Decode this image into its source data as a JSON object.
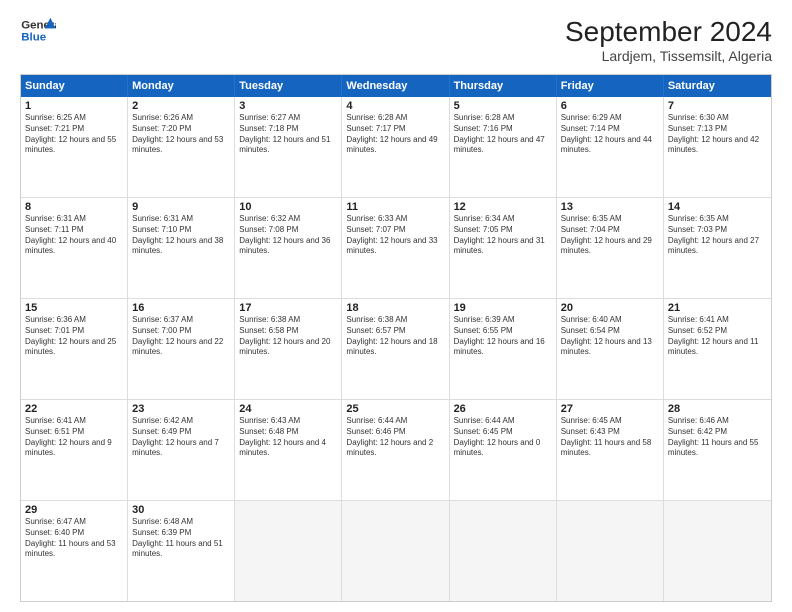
{
  "header": {
    "logo_line1": "General",
    "logo_line2": "Blue",
    "title": "September 2024",
    "subtitle": "Lardjem, Tissemsilt, Algeria"
  },
  "calendar": {
    "days": [
      "Sunday",
      "Monday",
      "Tuesday",
      "Wednesday",
      "Thursday",
      "Friday",
      "Saturday"
    ],
    "rows": [
      [
        {
          "day": "1",
          "rise": "6:25 AM",
          "set": "7:21 PM",
          "daylight": "12 hours and 55 minutes."
        },
        {
          "day": "2",
          "rise": "6:26 AM",
          "set": "7:20 PM",
          "daylight": "12 hours and 53 minutes."
        },
        {
          "day": "3",
          "rise": "6:27 AM",
          "set": "7:18 PM",
          "daylight": "12 hours and 51 minutes."
        },
        {
          "day": "4",
          "rise": "6:28 AM",
          "set": "7:17 PM",
          "daylight": "12 hours and 49 minutes."
        },
        {
          "day": "5",
          "rise": "6:28 AM",
          "set": "7:16 PM",
          "daylight": "12 hours and 47 minutes."
        },
        {
          "day": "6",
          "rise": "6:29 AM",
          "set": "7:14 PM",
          "daylight": "12 hours and 44 minutes."
        },
        {
          "day": "7",
          "rise": "6:30 AM",
          "set": "7:13 PM",
          "daylight": "12 hours and 42 minutes."
        }
      ],
      [
        {
          "day": "8",
          "rise": "6:31 AM",
          "set": "7:11 PM",
          "daylight": "12 hours and 40 minutes."
        },
        {
          "day": "9",
          "rise": "6:31 AM",
          "set": "7:10 PM",
          "daylight": "12 hours and 38 minutes."
        },
        {
          "day": "10",
          "rise": "6:32 AM",
          "set": "7:08 PM",
          "daylight": "12 hours and 36 minutes."
        },
        {
          "day": "11",
          "rise": "6:33 AM",
          "set": "7:07 PM",
          "daylight": "12 hours and 33 minutes."
        },
        {
          "day": "12",
          "rise": "6:34 AM",
          "set": "7:05 PM",
          "daylight": "12 hours and 31 minutes."
        },
        {
          "day": "13",
          "rise": "6:35 AM",
          "set": "7:04 PM",
          "daylight": "12 hours and 29 minutes."
        },
        {
          "day": "14",
          "rise": "6:35 AM",
          "set": "7:03 PM",
          "daylight": "12 hours and 27 minutes."
        }
      ],
      [
        {
          "day": "15",
          "rise": "6:36 AM",
          "set": "7:01 PM",
          "daylight": "12 hours and 25 minutes."
        },
        {
          "day": "16",
          "rise": "6:37 AM",
          "set": "7:00 PM",
          "daylight": "12 hours and 22 minutes."
        },
        {
          "day": "17",
          "rise": "6:38 AM",
          "set": "6:58 PM",
          "daylight": "12 hours and 20 minutes."
        },
        {
          "day": "18",
          "rise": "6:38 AM",
          "set": "6:57 PM",
          "daylight": "12 hours and 18 minutes."
        },
        {
          "day": "19",
          "rise": "6:39 AM",
          "set": "6:55 PM",
          "daylight": "12 hours and 16 minutes."
        },
        {
          "day": "20",
          "rise": "6:40 AM",
          "set": "6:54 PM",
          "daylight": "12 hours and 13 minutes."
        },
        {
          "day": "21",
          "rise": "6:41 AM",
          "set": "6:52 PM",
          "daylight": "12 hours and 11 minutes."
        }
      ],
      [
        {
          "day": "22",
          "rise": "6:41 AM",
          "set": "6:51 PM",
          "daylight": "12 hours and 9 minutes."
        },
        {
          "day": "23",
          "rise": "6:42 AM",
          "set": "6:49 PM",
          "daylight": "12 hours and 7 minutes."
        },
        {
          "day": "24",
          "rise": "6:43 AM",
          "set": "6:48 PM",
          "daylight": "12 hours and 4 minutes."
        },
        {
          "day": "25",
          "rise": "6:44 AM",
          "set": "6:46 PM",
          "daylight": "12 hours and 2 minutes."
        },
        {
          "day": "26",
          "rise": "6:44 AM",
          "set": "6:45 PM",
          "daylight": "12 hours and 0 minutes."
        },
        {
          "day": "27",
          "rise": "6:45 AM",
          "set": "6:43 PM",
          "daylight": "11 hours and 58 minutes."
        },
        {
          "day": "28",
          "rise": "6:46 AM",
          "set": "6:42 PM",
          "daylight": "11 hours and 55 minutes."
        }
      ],
      [
        {
          "day": "29",
          "rise": "6:47 AM",
          "set": "6:40 PM",
          "daylight": "11 hours and 53 minutes."
        },
        {
          "day": "30",
          "rise": "6:48 AM",
          "set": "6:39 PM",
          "daylight": "11 hours and 51 minutes."
        },
        null,
        null,
        null,
        null,
        null
      ]
    ]
  }
}
